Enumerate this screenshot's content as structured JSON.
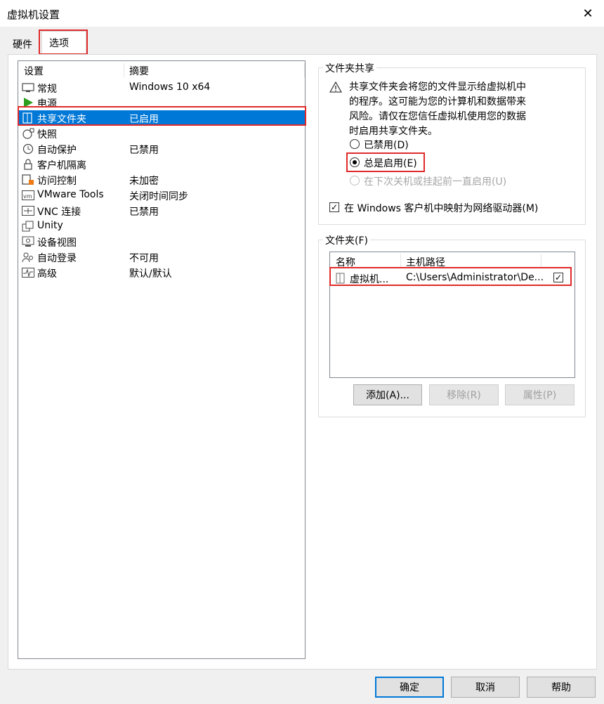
{
  "window": {
    "title": "虚拟机设置",
    "close_icon": "close-icon"
  },
  "tabs": [
    {
      "label": "硬件"
    },
    {
      "label": "选项"
    }
  ],
  "settings": {
    "header": {
      "col1": "设置",
      "col2": "摘要"
    },
    "items": [
      {
        "label": "常规",
        "summary": "Windows 10 x64",
        "icon": "monitor-icon"
      },
      {
        "label": "电源",
        "summary": "",
        "icon": "play-icon"
      },
      {
        "label": "共享文件夹",
        "summary": "已启用",
        "icon": "shared-folder-icon"
      },
      {
        "label": "快照",
        "summary": "",
        "icon": "snapshot-icon"
      },
      {
        "label": "自动保护",
        "summary": "已禁用",
        "icon": "clock-icon"
      },
      {
        "label": "客户机隔离",
        "summary": "",
        "icon": "lock-icon"
      },
      {
        "label": "访问控制",
        "summary": "未加密",
        "icon": "access-control-icon"
      },
      {
        "label": "VMware Tools",
        "summary": "关闭时间同步",
        "icon": "vm-icon"
      },
      {
        "label": "VNC 连接",
        "summary": "已禁用",
        "icon": "vnc-icon"
      },
      {
        "label": "Unity",
        "summary": "",
        "icon": "unity-icon"
      },
      {
        "label": "设备视图",
        "summary": "",
        "icon": "device-view-icon"
      },
      {
        "label": "自动登录",
        "summary": "不可用",
        "icon": "users-icon"
      },
      {
        "label": "高级",
        "summary": "默认/默认",
        "icon": "advanced-icon"
      }
    ]
  },
  "sharing": {
    "title": "文件夹共享",
    "warning": [
      "共享文件夹会将您的文件显示给虚拟机中",
      "的程序。这可能为您的计算机和数据带来",
      "风险。请仅在您信任虚拟机使用您的数据",
      "时启用共享文件夹。"
    ],
    "options": [
      {
        "label": "已禁用(D)",
        "checked": false,
        "disabled": false
      },
      {
        "label": "总是启用(E)",
        "checked": true,
        "disabled": false
      },
      {
        "label": "在下次关机或挂起前一直启用(U)",
        "checked": false,
        "disabled": true
      }
    ],
    "map_drive": {
      "label": "在 Windows 客户机中映射为网络驱动器(M)",
      "checked": true
    }
  },
  "folders": {
    "title": "文件夹(F)",
    "columns": {
      "name": "名称",
      "path": "主机路径"
    },
    "rows": [
      {
        "name": "虚拟机...",
        "path": "C:\\Users\\Administrator\\De...",
        "enabled": true
      }
    ],
    "buttons": {
      "add": "添加(A)...",
      "remove": "移除(R)",
      "properties": "属性(P)"
    }
  },
  "footer": {
    "ok": "确定",
    "cancel": "取消",
    "help": "帮助"
  },
  "colors": {
    "selection": "#0078d7",
    "highlight_box": "#e02a2a"
  }
}
